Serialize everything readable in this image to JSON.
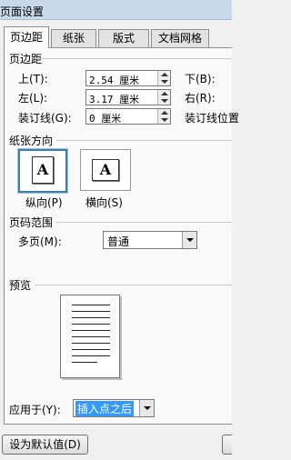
{
  "window": {
    "title": "页面设置"
  },
  "tabs": [
    {
      "label": "页边距",
      "active": true
    },
    {
      "label": "纸张",
      "active": false
    },
    {
      "label": "版式",
      "active": false
    },
    {
      "label": "文档网格",
      "active": false
    }
  ],
  "margins": {
    "group_label": "页边距",
    "top_label": "上(T):",
    "top_value": "2.54 厘米",
    "bottom_label": "下(B):",
    "left_label": "左(L):",
    "left_value": "3.17 厘米",
    "right_label": "右(R):",
    "gutter_label": "装订线(G):",
    "gutter_value": "0 厘米",
    "gutter_pos_label": "装订线位置"
  },
  "orientation": {
    "group_label": "纸张方向",
    "portrait_label": "纵向(P)",
    "landscape_label": "横向(S)",
    "icon_letter": "A",
    "selected": "portrait"
  },
  "pages": {
    "group_label": "页码范围",
    "multiple_label": "多页(M):",
    "multiple_value": "普通"
  },
  "preview": {
    "group_label": "预览",
    "apply_label": "应用于(Y):",
    "apply_value": "插入点之后"
  },
  "footer": {
    "default_button": "设为默认值(D)"
  },
  "colors": {
    "selection_bg": "#3399ff",
    "titlebar": "#c8d9ec",
    "selected_border": "#3c7fb1"
  },
  "icons": [
    "spin-up-icon",
    "spin-down-icon",
    "dropdown-arrow-icon",
    "portrait-page-icon",
    "landscape-page-icon",
    "page-preview-icon"
  ]
}
